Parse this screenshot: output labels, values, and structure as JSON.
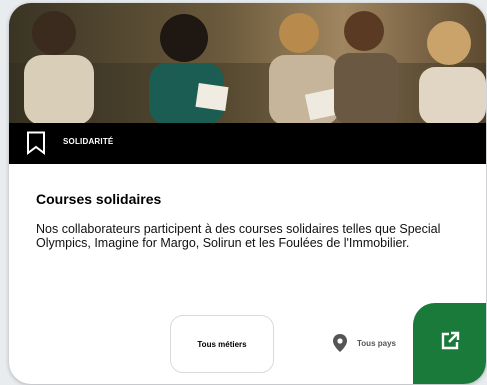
{
  "card": {
    "category": "SOLIDARITÉ",
    "title": "Courses solidaires",
    "description": "Nos collaborateurs participent à des courses solidaires telles que Special Olympics, Imagine for Margo, Solirun et les Foulées de l'Immobilier.",
    "filters": {
      "job_label": "Tous métiers",
      "country_label": "Tous pays"
    },
    "icons": {
      "bookmark": "bookmark-icon",
      "location": "map-pin-icon",
      "open": "external-link-icon"
    },
    "colors": {
      "accent": "#1a7a3a",
      "category_bar": "#000000"
    }
  }
}
